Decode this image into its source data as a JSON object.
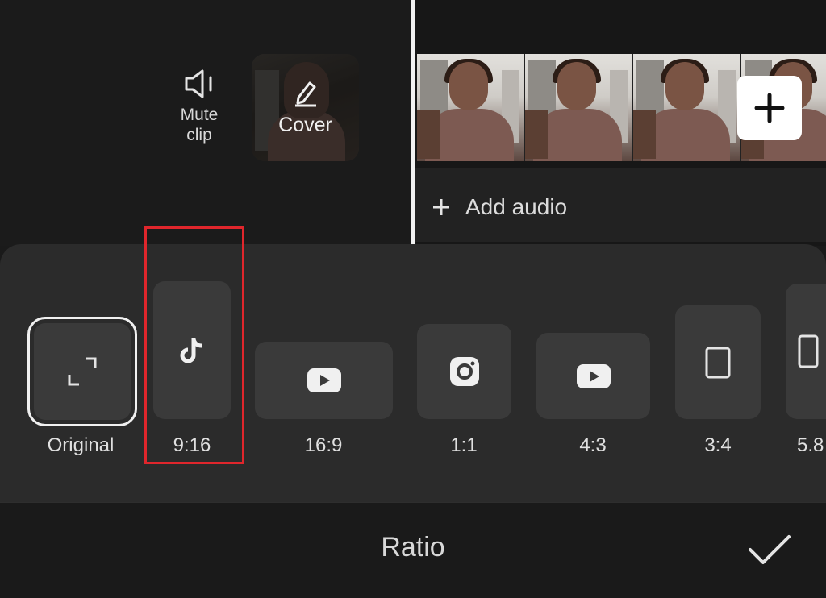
{
  "toolbar": {
    "mute_label_line1": "Mute",
    "mute_label_line2": "clip",
    "cover_label": "Cover",
    "add_audio_label": "Add audio"
  },
  "ratio_options": [
    {
      "label": "Original",
      "icon": "expand-corners-icon",
      "selected": true
    },
    {
      "label": "9:16",
      "icon": "tiktok-icon"
    },
    {
      "label": "16:9",
      "icon": "youtube-icon"
    },
    {
      "label": "1:1",
      "icon": "instagram-icon"
    },
    {
      "label": "4:3",
      "icon": "youtube-icon"
    },
    {
      "label": "3:4",
      "icon": "portrait-rect-icon"
    },
    {
      "label": "5.8",
      "icon": "portrait-rect-icon"
    }
  ],
  "footer": {
    "title": "Ratio",
    "confirm_icon": "checkmark-icon"
  },
  "colors": {
    "highlight": "#e0262c",
    "panel": "#2b2b2b",
    "tile": "#3a3a3a"
  }
}
